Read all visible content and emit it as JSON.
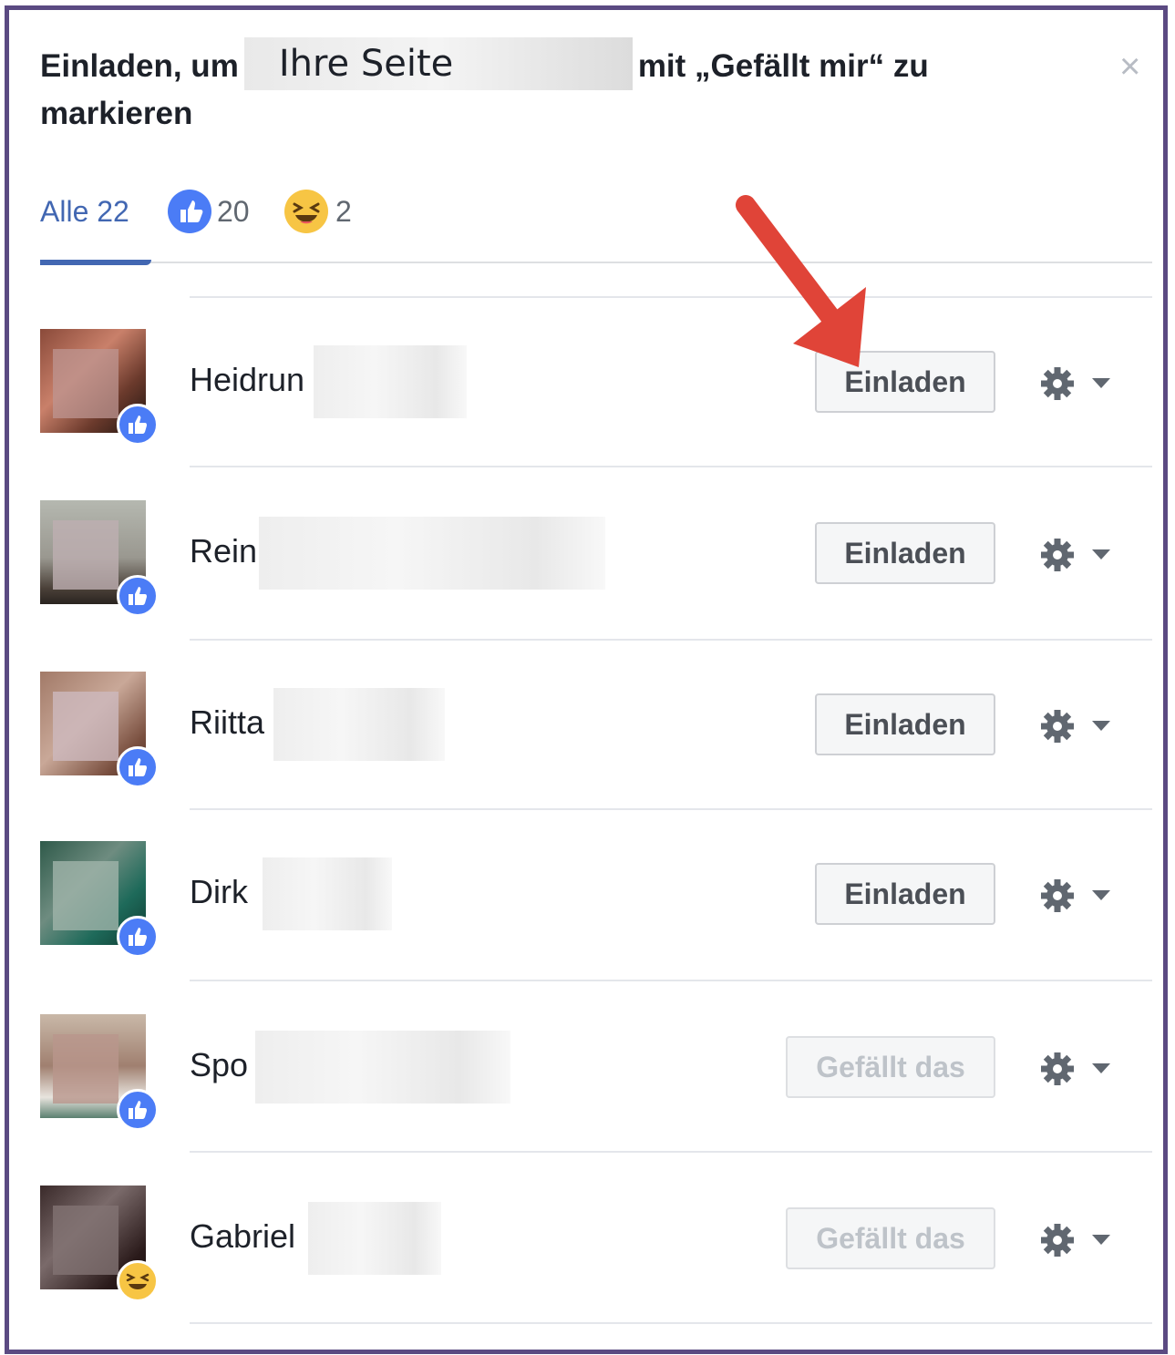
{
  "dialog": {
    "title_before": "Einladen, um",
    "title_redacted": "Ihre Seite",
    "title_after": "mit „Gefällt mir“ zu markieren",
    "close_label": "×"
  },
  "tabs": {
    "all_label": "Alle 22",
    "like_count": "20",
    "haha_count": "2"
  },
  "people": [
    {
      "name": "Heidrun",
      "button": "Einladen",
      "reaction": "like"
    },
    {
      "name": "Rein",
      "button": "Einladen",
      "reaction": "like"
    },
    {
      "name": "Riitta",
      "button": "Einladen",
      "reaction": "like"
    },
    {
      "name": "Dirk",
      "button": "Einladen",
      "reaction": "like"
    },
    {
      "name": "Spo",
      "button": "Gefällt das",
      "reaction": "like"
    },
    {
      "name": "Gabriel",
      "button": "Gefällt das",
      "reaction": "haha"
    }
  ],
  "colors": {
    "frame": "#5b4a82",
    "accent": "#4267b2",
    "like_badge": "#4b7cf6",
    "haha_badge": "#f7c544",
    "annotation_arrow": "#e04438"
  },
  "icons": {
    "close": "close-icon",
    "like": "thumbs-up-icon",
    "haha": "laughing-emoji-icon",
    "settings": "gear-icon",
    "dropdown": "caret-down-icon"
  }
}
